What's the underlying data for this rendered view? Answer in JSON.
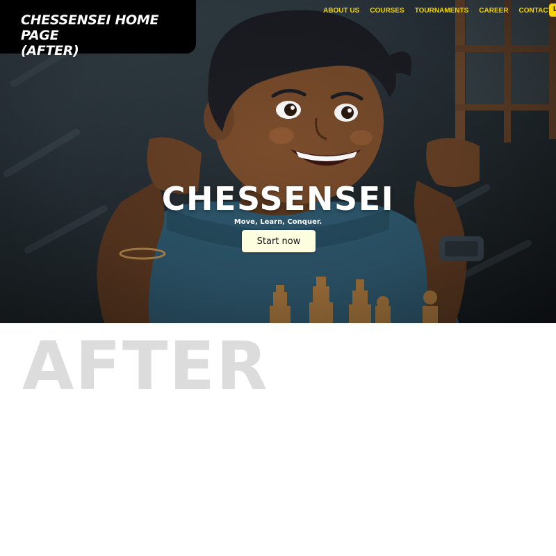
{
  "badge": {
    "line1": "CHESSENSEI HOME PAGE",
    "line2": "(AFTER)"
  },
  "nav": {
    "items": [
      "ABOUT US",
      "COURSES",
      "TOURNAMENTS",
      "CAREER",
      "CONTACT US"
    ],
    "cta_label": "L"
  },
  "hero": {
    "title": "CHESSENSEI",
    "tagline": "Move, Learn, Conquer.",
    "button_label": "Start now"
  },
  "after_label": "AFTER",
  "colors": {
    "nav_text": "#f5d400",
    "button_bg": "#fdfde0",
    "badge_bg": "#000000",
    "after_text": "#dcdcdc"
  }
}
